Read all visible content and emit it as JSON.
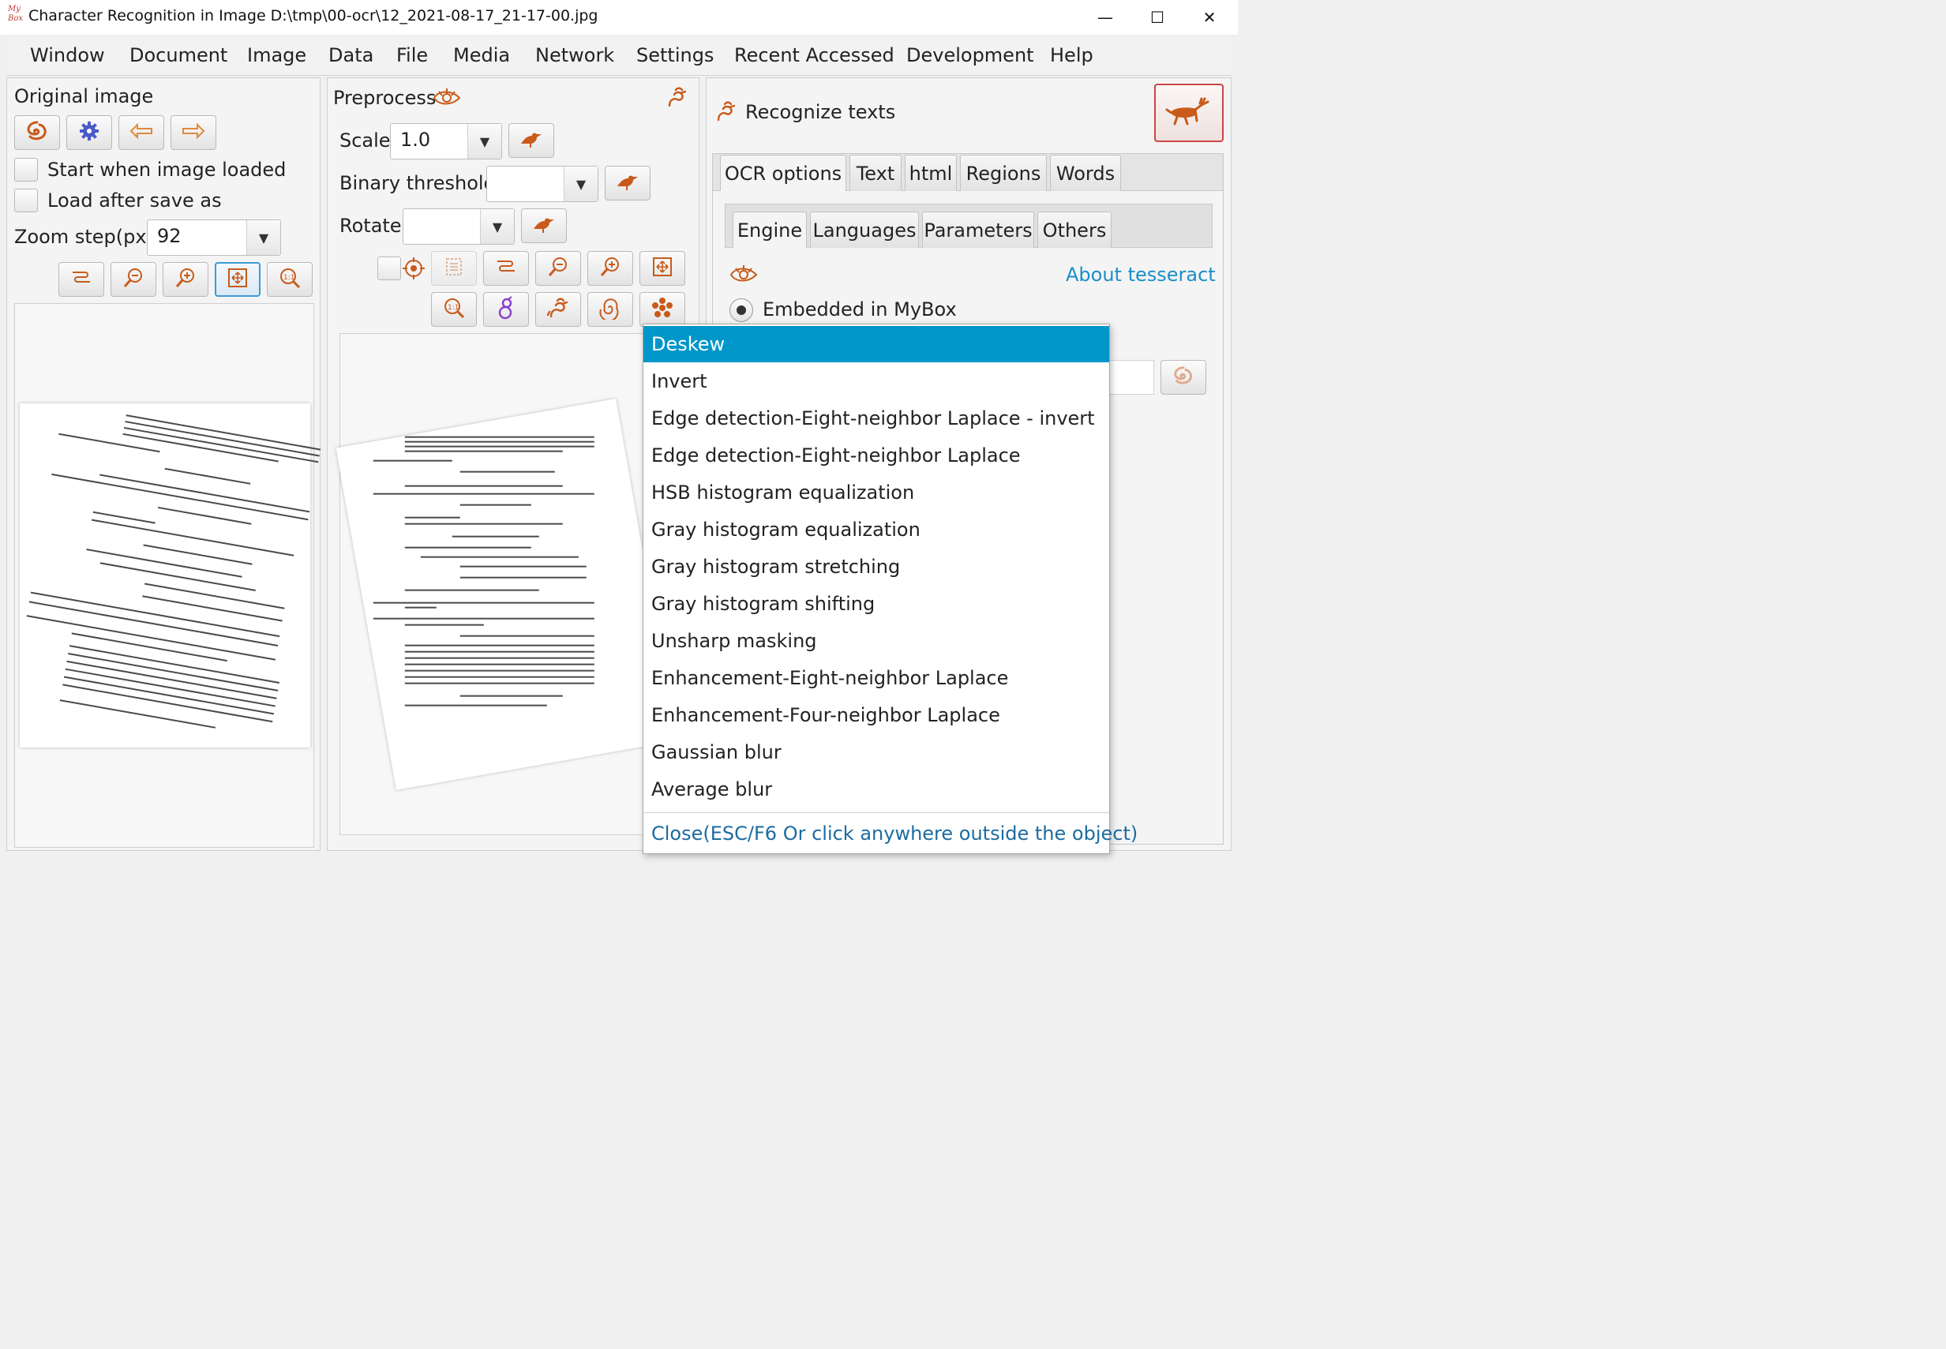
{
  "window": {
    "title": "Character Recognition in Image D:\\tmp\\00-ocr\\12_2021-08-17_21-17-00.jpg",
    "logo_text": "My Box",
    "minimize_glyph": "—",
    "maximize_glyph": "☐",
    "close_glyph": "✕"
  },
  "menu": [
    "Window",
    "Document",
    "Image",
    "Data",
    "File",
    "Media",
    "Network",
    "Settings",
    "Recent Accessed",
    "Development",
    "Help"
  ],
  "left_panel": {
    "title": "Original image",
    "start_when_loaded": "Start when image loaded",
    "load_after_save": "Load after save as",
    "zoom_step_label": "Zoom step(px)",
    "zoom_step_value": "92"
  },
  "middle_panel": {
    "title": "Preprocess",
    "scale_label": "Scale",
    "scale_value": "1.0",
    "binary_label": "Binary threshold",
    "binary_value": "",
    "rotate_label": "Rotate",
    "rotate_value": ""
  },
  "right_panel": {
    "title": "Recognize texts",
    "main_tabs": [
      "OCR options",
      "Text",
      "html",
      "Regions",
      "Words"
    ],
    "sub_tabs": [
      "Engine",
      "Languages",
      "Parameters",
      "Others"
    ],
    "about_link": "About tesseract",
    "engine_option": "Embedded in MyBox"
  },
  "popup_menu": {
    "items": [
      "Deskew",
      "Invert",
      "Edge detection-Eight-neighbor Laplace - invert",
      "Edge detection-Eight-neighbor Laplace",
      "HSB histogram equalization",
      "Gray histogram equalization",
      "Gray histogram stretching",
      "Gray histogram shifting",
      "Unsharp masking",
      "Enhancement-Eight-neighbor Laplace",
      "Enhancement-Four-neighbor Laplace",
      "Gaussian blur",
      "Average blur"
    ],
    "selected_index": 0,
    "close_label": "Close(ESC/F6 Or click anywhere outside the object)"
  },
  "colors": {
    "accent": "#0096c9",
    "link": "#1c6ba0",
    "icon_orange": "#c85a1a",
    "selection_border": "#3e9ad6"
  },
  "icons": [
    "mybox-logo-icon",
    "gear-icon",
    "arrow-left-icon",
    "arrow-right-icon",
    "pane-size-icon",
    "zoom-out-icon",
    "zoom-in-icon",
    "fit-window-icon",
    "actual-size-icon",
    "bird-icon",
    "target-icon",
    "select-all-icon",
    "eye-icon",
    "gourd-icon",
    "dragon-icon",
    "swirl-icon",
    "flower-icon",
    "deer-icon"
  ]
}
